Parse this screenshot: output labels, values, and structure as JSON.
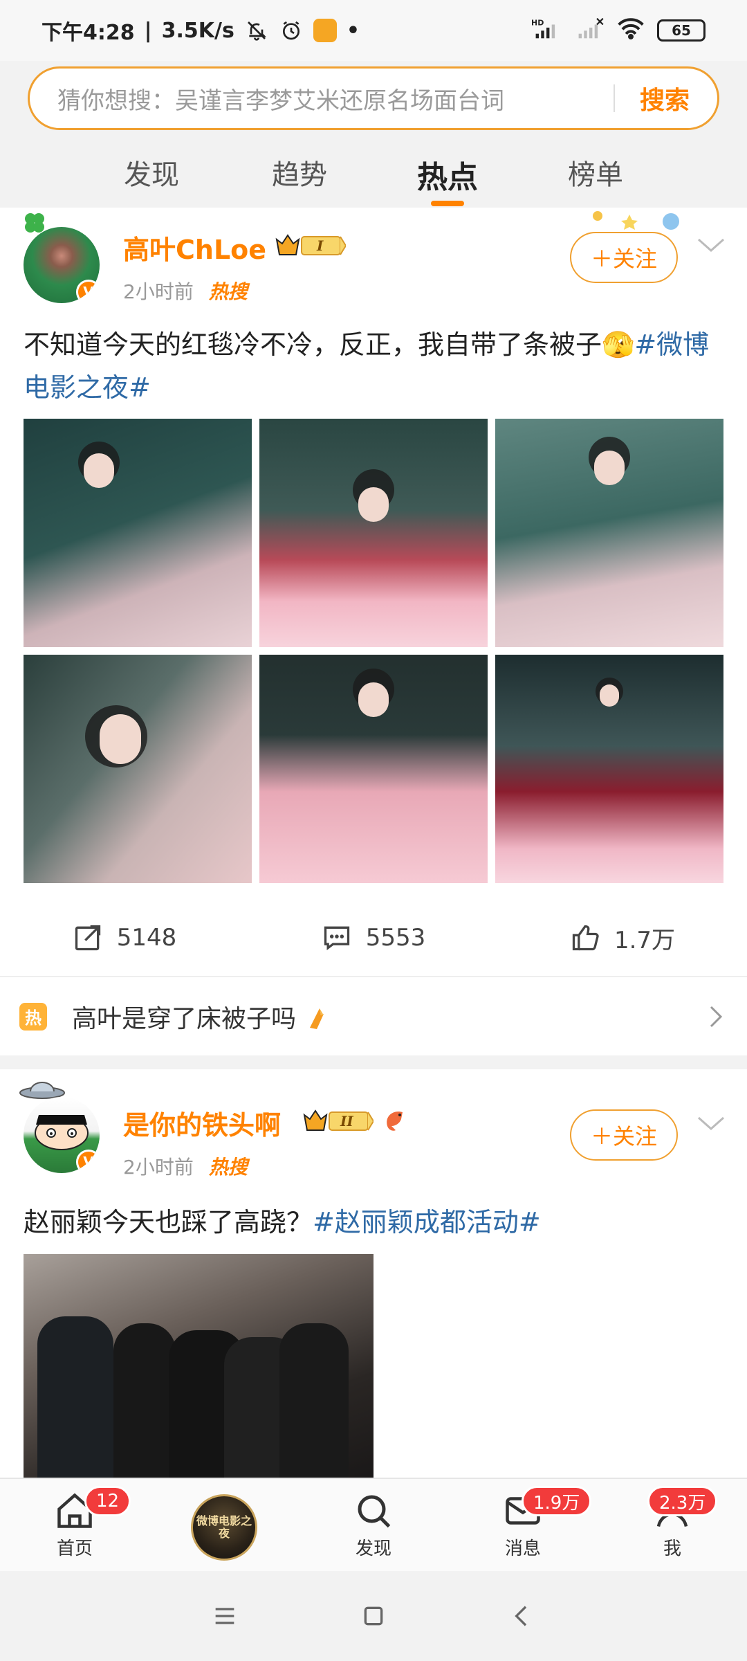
{
  "status_bar": {
    "time": "下午4:28",
    "speed": "3.5K/s",
    "network": "HD",
    "battery": "65"
  },
  "search": {
    "placeholder": "猜你想搜：吴谨言李梦艾米还原名场面台词",
    "button": "搜索"
  },
  "tabs": [
    {
      "label": "发现"
    },
    {
      "label": "趋势"
    },
    {
      "label": "热点",
      "active": true
    },
    {
      "label": "榜单"
    }
  ],
  "posts": [
    {
      "author": "高叶ChLoe",
      "level": "I",
      "time": "2小时前",
      "hot_tag": "热搜",
      "follow": "关注",
      "text": "不知道今天的红毯冷不冷，反正，我自带了条被子",
      "emoji": "🫣",
      "hashtag": "#微博电影之夜#",
      "image_count": 6,
      "reposts": "5148",
      "comments": "5553",
      "likes": "1.7万",
      "hot_topic": {
        "badge": "热",
        "text": "高叶是穿了床被子吗"
      }
    },
    {
      "author": "是你的铁头啊",
      "level": "II",
      "time": "2小时前",
      "hot_tag": "热搜",
      "follow": "关注",
      "text": "赵丽颖今天也踩了高跷？",
      "hashtag": "#赵丽颖成都活动#"
    }
  ],
  "bottom_nav": [
    {
      "label": "首页",
      "icon": "home-icon",
      "badge": "12"
    },
    {
      "label": "",
      "icon": "weibo-movie-night-logo",
      "logo_text": "微博电影之夜"
    },
    {
      "label": "发现",
      "icon": "search-icon"
    },
    {
      "label": "消息",
      "icon": "message-icon",
      "badge": "1.9万"
    },
    {
      "label": "我",
      "icon": "profile-icon",
      "badge": "2.3万"
    }
  ],
  "colors": {
    "accent": "#ff8200",
    "hashtag": "#2f6aa6",
    "badge": "#f23b3b"
  }
}
